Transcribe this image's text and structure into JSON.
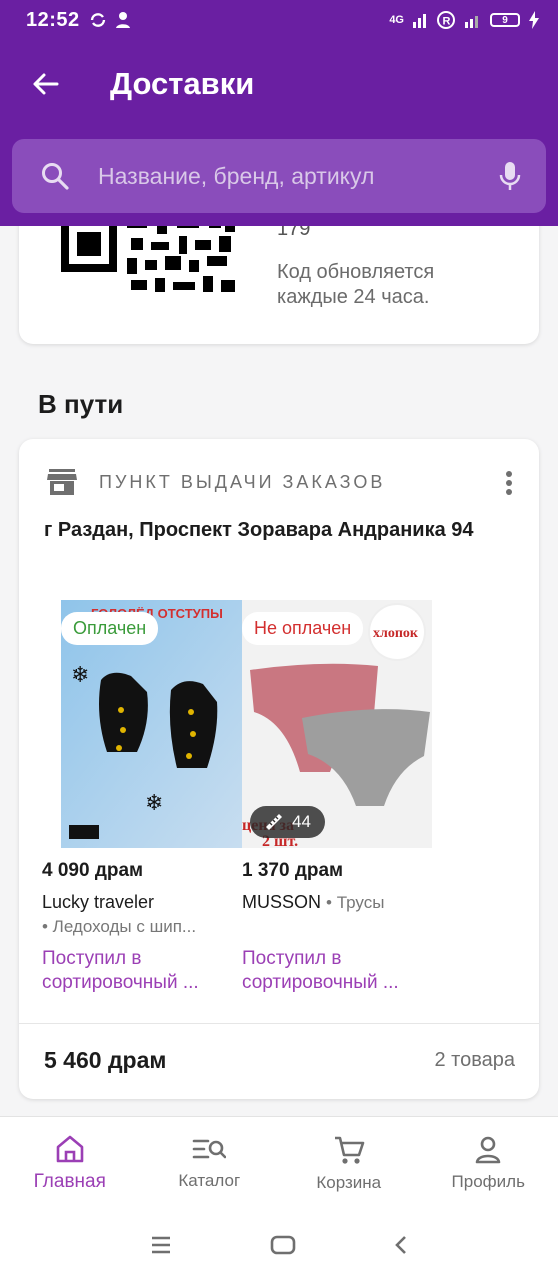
{
  "status_bar": {
    "time": "12:52",
    "network": "4G",
    "battery": "9"
  },
  "app_bar": {
    "title": "Доставки"
  },
  "search": {
    "placeholder": "Название, бренд, артикул"
  },
  "qr_card": {
    "code": "179",
    "note": "Код обновляется каждые 24 часа."
  },
  "section": {
    "title": "В пути"
  },
  "order": {
    "pickup_label": "ПУНКТ ВЫДАЧИ ЗАКАЗОВ",
    "address": "г Раздан, Проспект Зоравара Андраника 94",
    "products": [
      {
        "payment_status": "Оплачен",
        "price": "4 090 драм",
        "brand": "Lucky traveler",
        "subcategory": "• Ледоходы с шип...",
        "status": "Поступил в сортировочный ...",
        "image_text": "ГОЛОЛЁД ОТСТУПЫ"
      },
      {
        "payment_status": "Не оплачен",
        "price": "1 370 драм",
        "brand": "MUSSON",
        "category": "• Трусы",
        "status": "Поступил в сортировочный ...",
        "size": "44",
        "image_text": "хлопок"
      }
    ],
    "total": "5 460 драм",
    "count": "2 товара"
  },
  "bottom_nav": [
    {
      "label": "Главная"
    },
    {
      "label": "Каталог"
    },
    {
      "label": "Корзина"
    },
    {
      "label": "Профиль"
    }
  ],
  "colors": {
    "primary": "#6a1fa2",
    "accent": "#9b3fb5",
    "paid": "#3a9b3a",
    "unpaid": "#d32f2f"
  }
}
